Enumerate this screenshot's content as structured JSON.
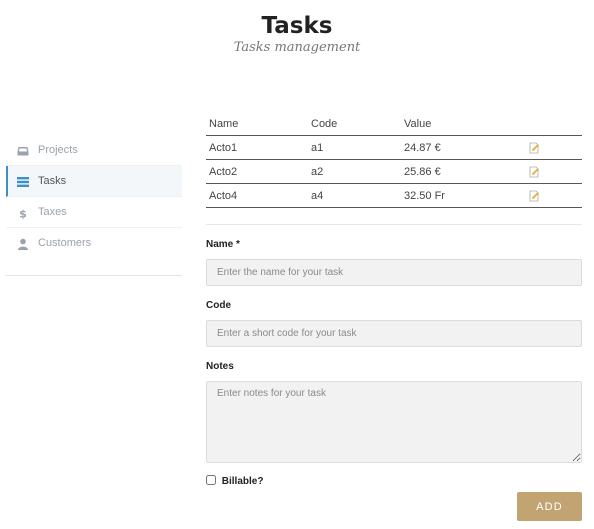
{
  "header": {
    "title": "Tasks",
    "subtitle": "Tasks management"
  },
  "sidebar": {
    "items": [
      {
        "label": "Projects",
        "icon": "inbox-icon",
        "active": false
      },
      {
        "label": "Tasks",
        "icon": "list-icon",
        "active": true
      },
      {
        "label": "Taxes",
        "icon": "dollar-icon",
        "active": false
      },
      {
        "label": "Customers",
        "icon": "user-icon",
        "active": false
      }
    ]
  },
  "table": {
    "columns": [
      "Name",
      "Code",
      "Value"
    ],
    "rows": [
      {
        "name": "Acto1",
        "code": "a1",
        "value": "24.87 €"
      },
      {
        "name": "Acto2",
        "code": "a2",
        "value": "25.86 €"
      },
      {
        "name": "Acto4",
        "code": "a4",
        "value": "32.50 Fr"
      }
    ]
  },
  "form": {
    "name_label": "Name *",
    "name_placeholder": "Enter the name for your task",
    "code_label": "Code",
    "code_placeholder": "Enter a short code for your task",
    "notes_label": "Notes",
    "notes_placeholder": "Enter notes for your task",
    "billable_label": "Billable?",
    "billable_checked": false,
    "add_label": "ADD"
  },
  "colors": {
    "accent": "#3d8fc6",
    "button": "#c2a472",
    "sidebar_text": "#9aa3ad"
  }
}
